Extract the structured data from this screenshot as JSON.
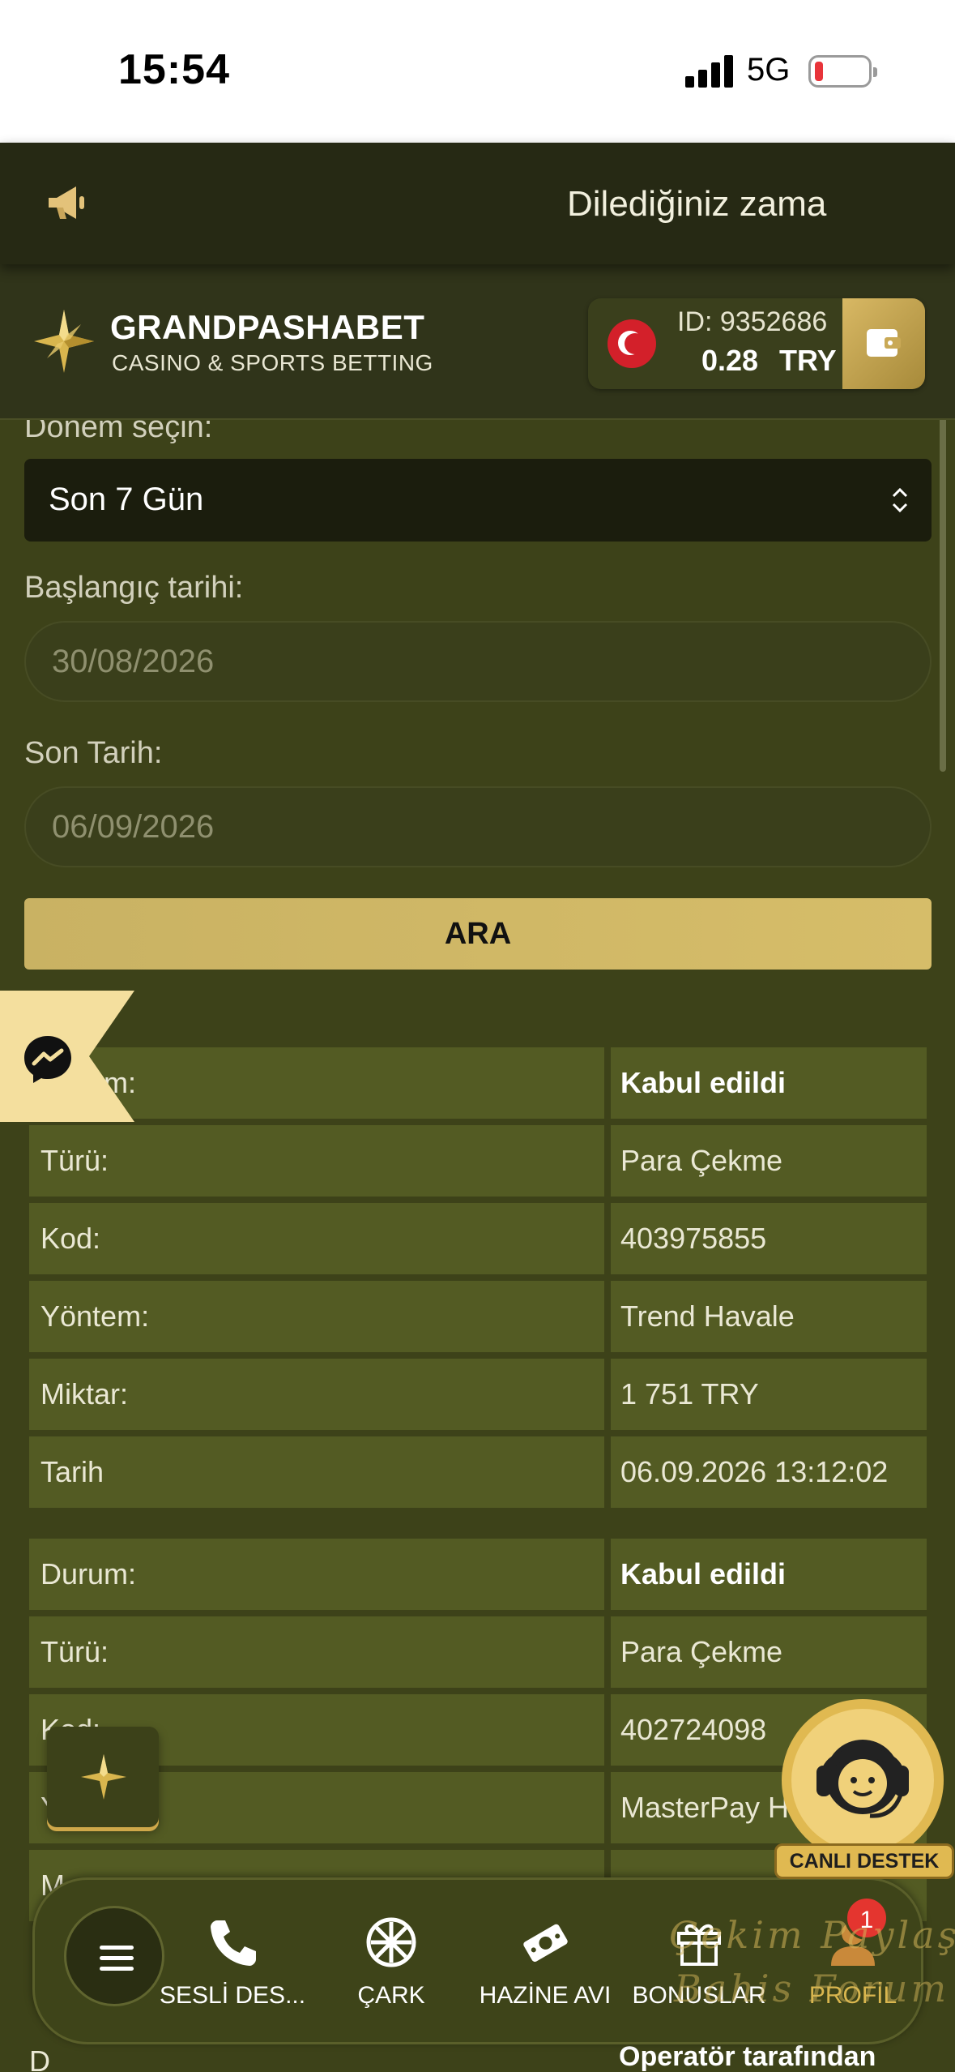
{
  "status_bar": {
    "time": "15:54",
    "network": "5G",
    "battery_level": 0.15
  },
  "announcement": {
    "text": "Dilediğiniz zama",
    "icon": "megaphone-icon"
  },
  "header": {
    "brand_name": "GRANDPASHABET",
    "brand_subtitle": "CASINO & SPORTS BETTING",
    "account_id": "ID: 9352686",
    "balance": "0.28",
    "currency": "TRY",
    "wallet_icon": "wallet-icon"
  },
  "form": {
    "period_label": "Dönem seçin:",
    "period_value": "Son 7 Gün",
    "start_label": "Başlangıç tarihi:",
    "start_value": "30/08/2026",
    "end_label": "Son Tarih:",
    "end_value": "06/09/2026",
    "search_button": "ARA"
  },
  "transactions": [
    {
      "rows": [
        {
          "label": "Durum:",
          "value": "Kabul edildi",
          "strong": true
        },
        {
          "label": "Türü:",
          "value": "Para Çekme"
        },
        {
          "label": "Kod:",
          "value": "403975855"
        },
        {
          "label": "Yöntem:",
          "value": "Trend Havale"
        },
        {
          "label": "Miktar:",
          "value": "1 751 TRY"
        },
        {
          "label": "Tarih",
          "value": "06.09.2026 13:12:02"
        }
      ]
    },
    {
      "rows": [
        {
          "label": "Durum:",
          "value": "Kabul edildi",
          "strong": true
        },
        {
          "label": "Türü:",
          "value": "Para Çekme"
        },
        {
          "label": "Kod:",
          "value": "402724098"
        },
        {
          "label": "Yöntem:",
          "value": "MasterPay Ha"
        },
        {
          "label": "M",
          "value": ""
        }
      ]
    }
  ],
  "bottom_peek": {
    "label": "D",
    "value": "Operatör tarafından"
  },
  "support": {
    "label": "CANLI DESTEK"
  },
  "bottom_nav": {
    "items": [
      {
        "label": "SESLİ DES...",
        "icon": "phone-icon"
      },
      {
        "label": "ÇARK",
        "icon": "wheel-icon"
      },
      {
        "label": "HAZİNE AVI",
        "icon": "treasure-icon"
      },
      {
        "label": "BONUSLAR",
        "icon": "gift-icon"
      },
      {
        "label": "PROFİL",
        "icon": "profile-icon",
        "badge": "1"
      }
    ]
  },
  "watermark": {
    "line1": "Çekim Paylaş",
    "line2": "Bahis Forum"
  },
  "colors": {
    "background": "#3d4219",
    "accent_gold": "#d6bd69",
    "table_cell": "#535b23"
  }
}
